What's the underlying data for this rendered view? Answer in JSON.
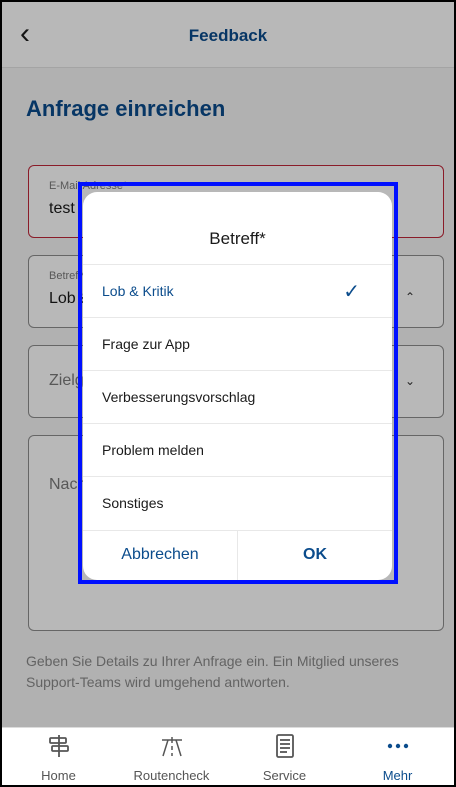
{
  "header": {
    "title": "Feedback",
    "back_icon": "chevron-left-icon"
  },
  "form": {
    "page_title": "Anfrage einreichen",
    "email": {
      "label": "E-Mail Adresse*",
      "value": "test"
    },
    "subject": {
      "label": "Betreff*",
      "value": "Lob & Kritik"
    },
    "target": {
      "placeholder": "Zielgruppe"
    },
    "message": {
      "placeholder": "Nachricht"
    },
    "help_text": "Geben Sie Details zu Ihrer Anfrage ein. Ein Mitglied unseres Support-Teams wird umgehend antworten."
  },
  "dialog": {
    "title": "Betreff*",
    "options": [
      {
        "label": "Lob & Kritik",
        "selected": true
      },
      {
        "label": "Frage zur App",
        "selected": false
      },
      {
        "label": "Verbesserungsvorschlag",
        "selected": false
      },
      {
        "label": "Problem melden",
        "selected": false
      },
      {
        "label": "Sonstiges",
        "selected": false
      }
    ],
    "cancel_label": "Abbrechen",
    "ok_label": "OK",
    "check_icon": "checkmark-icon"
  },
  "bottom_nav": {
    "items": [
      {
        "label": "Home",
        "icon": "signpost-icon",
        "active": false
      },
      {
        "label": "Routencheck",
        "icon": "road-icon",
        "active": false
      },
      {
        "label": "Service",
        "icon": "document-icon",
        "active": false
      },
      {
        "label": "Mehr",
        "icon": "more-dots-icon",
        "active": true
      }
    ]
  },
  "colors": {
    "primary": "#0b4c8c",
    "error": "#c0283a",
    "highlight": "#0010ff"
  }
}
